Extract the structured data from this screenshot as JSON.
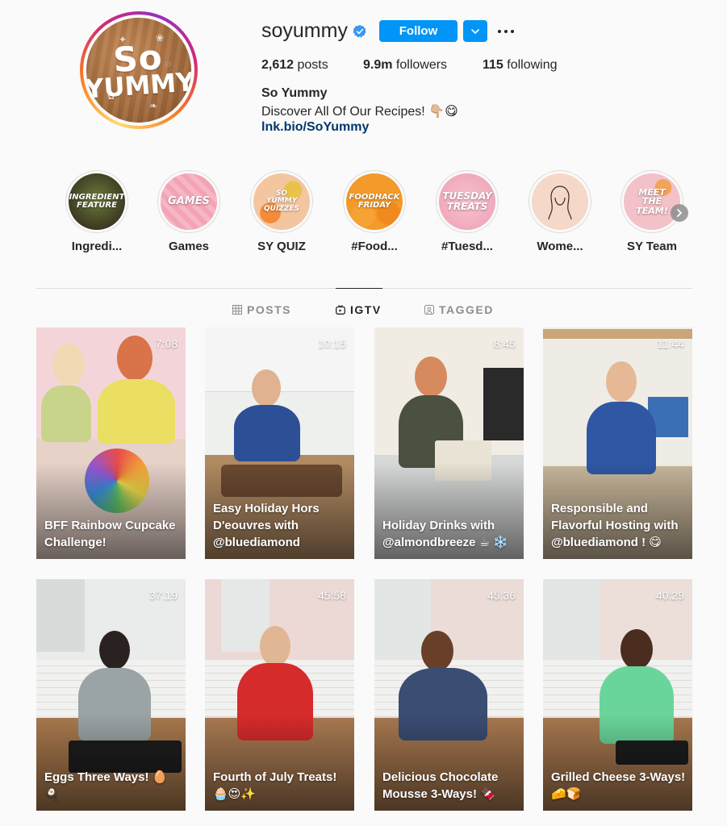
{
  "profile": {
    "username": "soyummy",
    "follow_label": "Follow",
    "stats": {
      "posts_count": "2,612",
      "posts_label": "posts",
      "followers_count": "9.9m",
      "followers_label": "followers",
      "following_count": "115",
      "following_label": "following"
    },
    "bio_name": "So Yummy",
    "bio_text": "Discover All Of Our Recipes! 👇🏼😋",
    "bio_link": "lnk.bio/SoYummy",
    "avatar_text_line1": "So",
    "avatar_text_line2": "YUMMY"
  },
  "highlights": [
    {
      "label": "Ingredi...",
      "art_text": "INGREDIENT FEATURE"
    },
    {
      "label": "Games",
      "art_text": "GAMES"
    },
    {
      "label": "SY QUIZ",
      "art_text": "SO YUMMY QUIZZES"
    },
    {
      "label": "#Food...",
      "art_text": "FOODHACK FRIDAY"
    },
    {
      "label": "#Tuesd...",
      "art_text": "TUESDAY TREATS"
    },
    {
      "label": "Wome...",
      "art_text": ""
    },
    {
      "label": "SY Team",
      "art_text": "MEET THE TEAM!"
    }
  ],
  "tabs": [
    {
      "label": "POSTS",
      "icon": "grid-icon",
      "active": false
    },
    {
      "label": "IGTV",
      "icon": "igtv-icon",
      "active": true
    },
    {
      "label": "TAGGED",
      "icon": "tagged-icon",
      "active": false
    }
  ],
  "videos": [
    {
      "duration": "7:08",
      "caption": "BFF Rainbow Cupcake Challenge!"
    },
    {
      "duration": "10:15",
      "caption": "Easy Holiday Hors D'eouvres with @bluediamond"
    },
    {
      "duration": "8:45",
      "caption": "Holiday Drinks with @almondbreeze ☕ ❄️"
    },
    {
      "duration": "11:44",
      "caption": "Responsible and Flavorful Hosting with @bluediamond ! 😋"
    },
    {
      "duration": "37:19",
      "caption": "Eggs Three Ways! 🥚🍳"
    },
    {
      "duration": "45:58",
      "caption": "Fourth of July Treats! 🧁😍✨"
    },
    {
      "duration": "45:36",
      "caption": "Delicious Chocolate Mousse 3-Ways! 🍫"
    },
    {
      "duration": "40:29",
      "caption": "Grilled Cheese 3-Ways! 🧀🍞"
    }
  ],
  "colors": {
    "accent": "#0095f6",
    "link": "#00376b",
    "verified": "#3897f0",
    "text": "#262626",
    "muted": "#8e8e8e",
    "border": "#dbdbdb",
    "background": "#fafafa"
  }
}
